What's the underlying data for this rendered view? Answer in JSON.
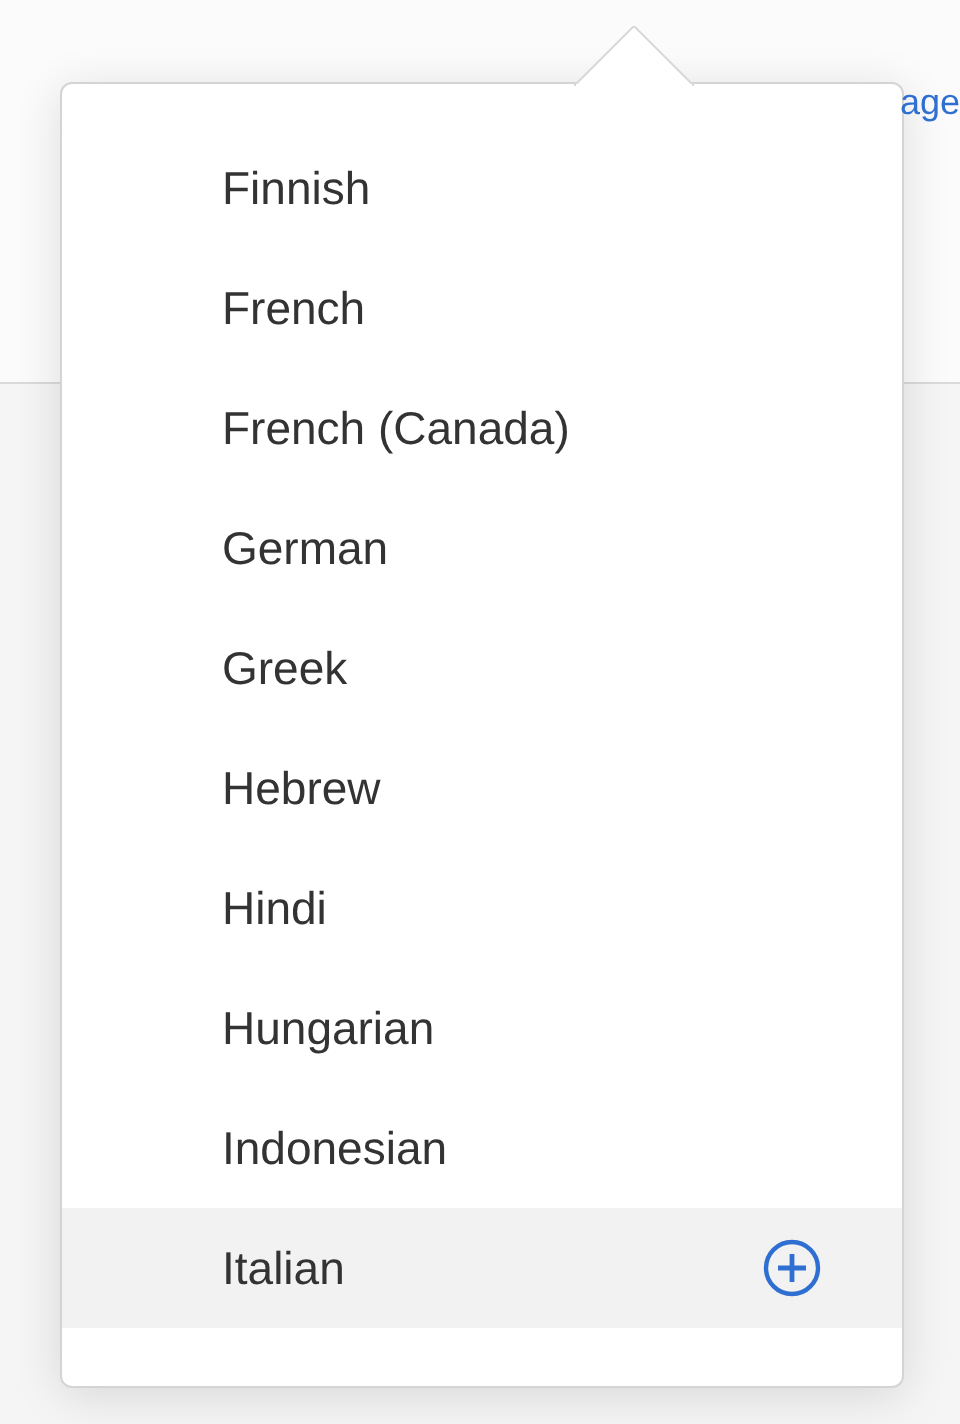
{
  "background_link": "age",
  "languages": [
    {
      "name": "Finnish",
      "selected": false
    },
    {
      "name": "French",
      "selected": false
    },
    {
      "name": "French (Canada)",
      "selected": false
    },
    {
      "name": "German",
      "selected": false
    },
    {
      "name": "Greek",
      "selected": false
    },
    {
      "name": "Hebrew",
      "selected": false
    },
    {
      "name": "Hindi",
      "selected": false
    },
    {
      "name": "Hungarian",
      "selected": false
    },
    {
      "name": "Indonesian",
      "selected": false
    },
    {
      "name": "Italian",
      "selected": true
    }
  ]
}
